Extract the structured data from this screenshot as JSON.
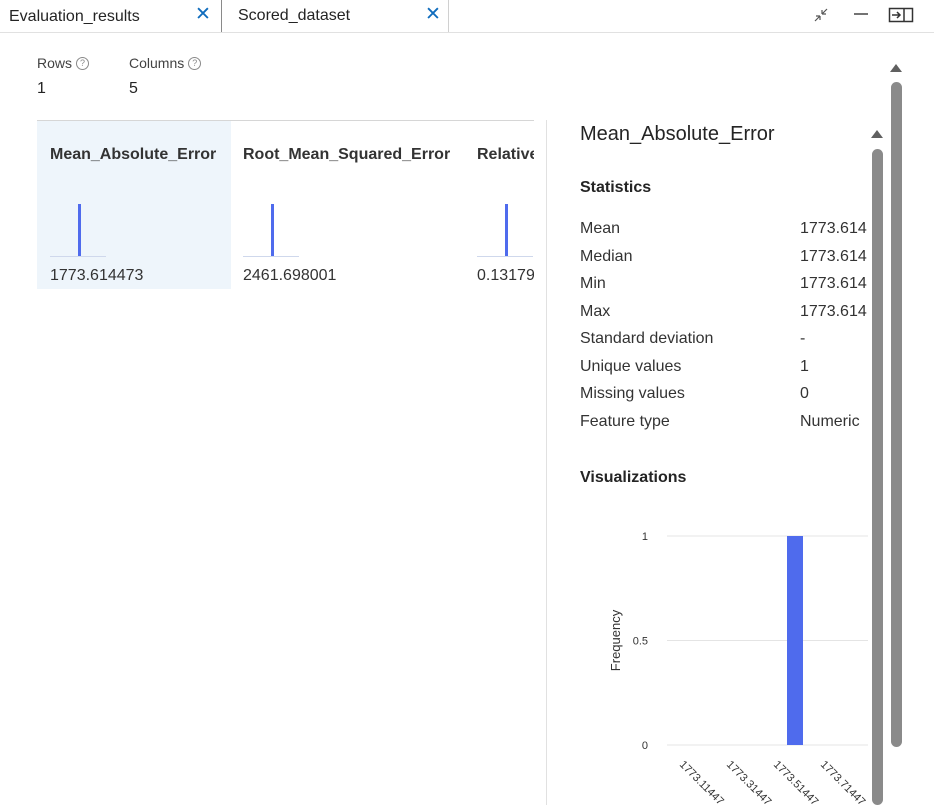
{
  "tabs": [
    {
      "label": "Evaluation_results",
      "close_icon": "close-icon"
    },
    {
      "label": "Scored_dataset",
      "close_icon": "close-icon"
    }
  ],
  "window_controls": [
    "collapse-icon",
    "minimize-icon",
    "dock-panel-icon"
  ],
  "summary": {
    "rows_label": "Rows",
    "rows_value": "1",
    "columns_label": "Columns",
    "columns_value": "5"
  },
  "columns": [
    {
      "name": "Mean_Absolute_Error",
      "value": "1773.614473"
    },
    {
      "name": "Root_Mean_Squared_Error",
      "value": "2461.698001"
    },
    {
      "name": "Relative",
      "value": "0.13179"
    }
  ],
  "details": {
    "title": "Mean_Absolute_Error",
    "statistics_heading": "Statistics",
    "stats": [
      {
        "label": "Mean",
        "value": "1773.614"
      },
      {
        "label": "Median",
        "value": "1773.614"
      },
      {
        "label": "Min",
        "value": "1773.614"
      },
      {
        "label": "Max",
        "value": "1773.614"
      },
      {
        "label": "Standard deviation",
        "value": "-"
      },
      {
        "label": "Unique values",
        "value": "1"
      },
      {
        "label": "Missing values",
        "value": "0"
      },
      {
        "label": "Feature type",
        "value": "Numeric"
      }
    ],
    "visualizations_heading": "Visualizations"
  },
  "colors": {
    "accent": "#4f6bed",
    "close": "#0f6cbd",
    "selected_bg": "#eef5fb"
  },
  "chart_data": {
    "type": "bar",
    "ylabel": "Frequency",
    "yticks": [
      "0",
      "0.5",
      "1"
    ],
    "ylim": [
      0,
      1
    ],
    "categories": [
      "1773.11447",
      "1773.31447",
      "1773.51447",
      "1773.71447",
      ""
    ],
    "values": [
      0,
      0,
      1,
      0,
      0
    ],
    "grid": true
  }
}
